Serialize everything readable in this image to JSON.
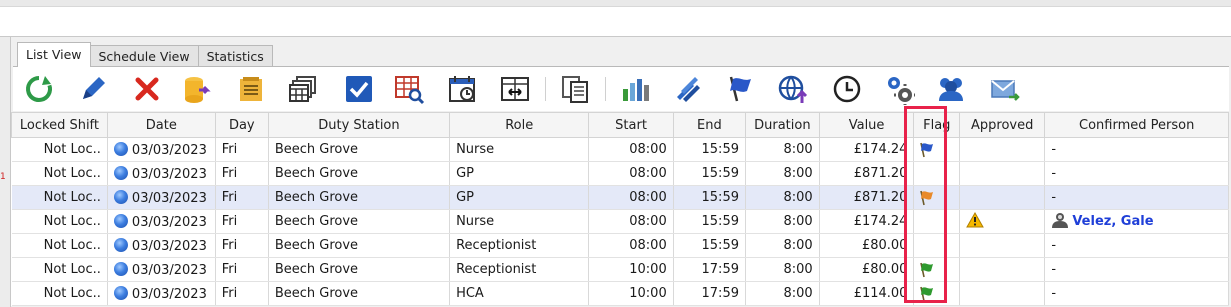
{
  "tabs": [
    {
      "label": "List View",
      "active": true
    },
    {
      "label": "Schedule View",
      "active": false
    },
    {
      "label": "Statistics",
      "active": false
    }
  ],
  "toolbar": {
    "icons": [
      "refresh-icon",
      "edit-pencil-icon",
      "delete-x-icon",
      "database-export-icon",
      "notes-icon",
      "window-stack-icon",
      "checkbox-icon",
      "table-search-icon",
      "calendar-clock-icon",
      "split-columns-icon",
      "copy-icon",
      "bar-chart-icon",
      "multi-pencil-icon",
      "flag-icon",
      "globe-upload-icon",
      "clock-icon",
      "settings-gears-icon",
      "users-icon",
      "email-forward-icon"
    ]
  },
  "columns": [
    "Locked Shift",
    "Date",
    "Day",
    "Duty Station",
    "Role",
    "Start",
    "End",
    "Duration",
    "Value",
    "Flag",
    "Approved",
    "Confirmed Person"
  ],
  "rows": [
    {
      "locked": "Not Loc..",
      "date": "03/03/2023",
      "day": "Fri",
      "station": "Beech Grove",
      "role": "Nurse",
      "start": "08:00",
      "end": "15:59",
      "duration": "8:00",
      "value": "£174.24",
      "flag": "blue",
      "approved": "",
      "person": "-"
    },
    {
      "locked": "Not Loc..",
      "date": "03/03/2023",
      "day": "Fri",
      "station": "Beech Grove",
      "role": "GP",
      "start": "08:00",
      "end": "15:59",
      "duration": "8:00",
      "value": "£871.20",
      "flag": "",
      "approved": "",
      "person": "-"
    },
    {
      "locked": "Not Loc..",
      "date": "03/03/2023",
      "day": "Fri",
      "station": "Beech Grove",
      "role": "GP",
      "start": "08:00",
      "end": "15:59",
      "duration": "8:00",
      "value": "£871.20",
      "flag": "orange",
      "approved": "",
      "person": "-"
    },
    {
      "locked": "Not Loc..",
      "date": "03/03/2023",
      "day": "Fri",
      "station": "Beech Grove",
      "role": "Nurse",
      "start": "08:00",
      "end": "15:59",
      "duration": "8:00",
      "value": "£174.24",
      "flag": "",
      "approved": "warning",
      "person": "Velez, Gale"
    },
    {
      "locked": "Not Loc..",
      "date": "03/03/2023",
      "day": "Fri",
      "station": "Beech Grove",
      "role": "Receptionist",
      "start": "08:00",
      "end": "15:59",
      "duration": "8:00",
      "value": "£80.00",
      "flag": "",
      "approved": "",
      "person": "-"
    },
    {
      "locked": "Not Loc..",
      "date": "03/03/2023",
      "day": "Fri",
      "station": "Beech Grove",
      "role": "Receptionist",
      "start": "10:00",
      "end": "17:59",
      "duration": "8:00",
      "value": "£80.00",
      "flag": "green",
      "approved": "",
      "person": "-"
    },
    {
      "locked": "Not Loc..",
      "date": "03/03/2023",
      "day": "Fri",
      "station": "Beech Grove",
      "role": "HCA",
      "start": "10:00",
      "end": "17:59",
      "duration": "8:00",
      "value": "£114.00",
      "flag": "green",
      "approved": "",
      "person": "-"
    }
  ],
  "flag_colors": {
    "blue": "#2a58c8",
    "orange": "#e88a2a",
    "green": "#2f9a2f"
  }
}
